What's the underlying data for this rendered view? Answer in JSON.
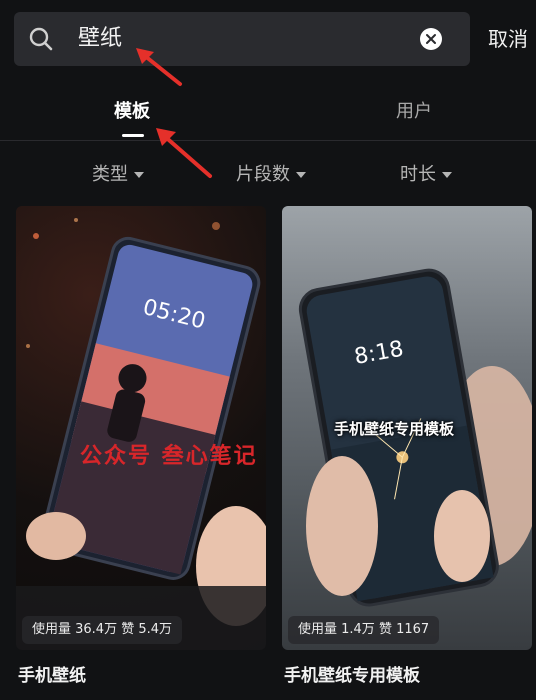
{
  "search": {
    "query": "壁纸",
    "cancel_label": "取消"
  },
  "tabs": [
    {
      "label": "模板",
      "active": true
    },
    {
      "label": "用户",
      "active": false
    }
  ],
  "filters": [
    {
      "label": "类型"
    },
    {
      "label": "片段数"
    },
    {
      "label": "时长"
    }
  ],
  "cards": [
    {
      "stats": "使用量 36.4万 赞 5.4万",
      "title": "手机壁纸",
      "phone_time": "05:20",
      "watermark": "公众号    叁心笔记"
    },
    {
      "stats": "使用量 1.4万 赞 1167",
      "title": "手机壁纸专用模板",
      "phone_time": "8:18",
      "caption": "手机壁纸专用模板"
    }
  ],
  "colors": {
    "background": "#111214",
    "search_bg": "#2a2b2f",
    "annotation_arrow": "#e5302a",
    "watermark": "#d8262a"
  }
}
